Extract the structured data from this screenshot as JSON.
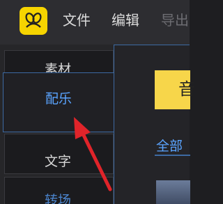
{
  "menu": {
    "file_label": "文件",
    "edit_label": "编辑",
    "export_label": "导出"
  },
  "sidebar": {
    "items": [
      {
        "label": "素材",
        "selected": false
      },
      {
        "label": "配乐",
        "selected": true
      },
      {
        "label": "文字",
        "selected": false
      },
      {
        "label": "转场",
        "selected": false
      }
    ]
  },
  "content": {
    "banner_text": "音",
    "tab_all_label": "全部"
  },
  "colors": {
    "accent": "#5aa4ff",
    "logo_bg": "#f6d400",
    "arrow": "#e0242a"
  }
}
